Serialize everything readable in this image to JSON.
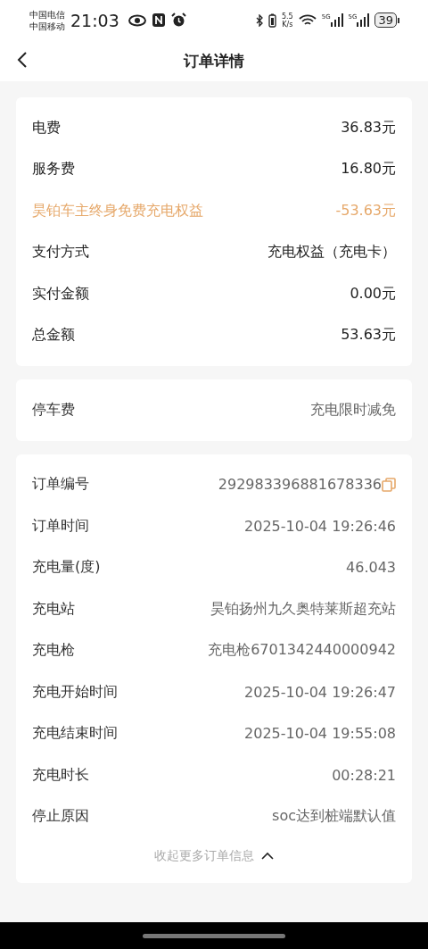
{
  "status_bar": {
    "carriers": [
      "中国电信",
      "中国移动"
    ],
    "time": "21:03",
    "speed_value": "5.5",
    "speed_unit": "K/s",
    "networks": [
      "5G",
      "5G"
    ],
    "battery": "39"
  },
  "header": {
    "title": "订单详情"
  },
  "cards": [
    {
      "rows": [
        {
          "kind": "plain",
          "label": "电费",
          "value": "36.83元"
        },
        {
          "kind": "plain",
          "label": "服务费",
          "value": "16.80元"
        },
        {
          "kind": "accent",
          "label": "昊铂车主终身免费充电权益",
          "value": "-53.63元"
        },
        {
          "kind": "plain",
          "label": "支付方式",
          "value": "充电权益（充电卡）"
        },
        {
          "kind": "plain",
          "label": "实付金额",
          "value": "0.00元"
        },
        {
          "kind": "plain",
          "label": "总金额",
          "value": "53.63元"
        }
      ]
    },
    {
      "rows": [
        {
          "kind": "muted",
          "label": "停车费",
          "value": "充电限时减免"
        }
      ]
    },
    {
      "rows": [
        {
          "kind": "copy",
          "label": "订单编号",
          "value": "292983396881678336"
        },
        {
          "kind": "muted",
          "label": "订单时间",
          "value": "2025-10-04 19:26:46"
        },
        {
          "kind": "muted",
          "label": "充电量(度)",
          "value": "46.043"
        },
        {
          "kind": "muted",
          "label": "充电站",
          "value": "昊铂扬州九久奥特莱斯超充站"
        },
        {
          "kind": "muted",
          "label": "充电枪",
          "value": "充电枪6701342440000942"
        },
        {
          "kind": "muted",
          "label": "充电开始时间",
          "value": "2025-10-04 19:26:47"
        },
        {
          "kind": "muted",
          "label": "充电结束时间",
          "value": "2025-10-04 19:55:08"
        },
        {
          "kind": "muted",
          "label": "充电时长",
          "value": "00:28:21"
        },
        {
          "kind": "muted",
          "label": "停止原因",
          "value": "soc达到桩端默认值"
        }
      ],
      "toggle": {
        "label": "收起更多订单信息",
        "expanded": true
      }
    }
  ]
}
